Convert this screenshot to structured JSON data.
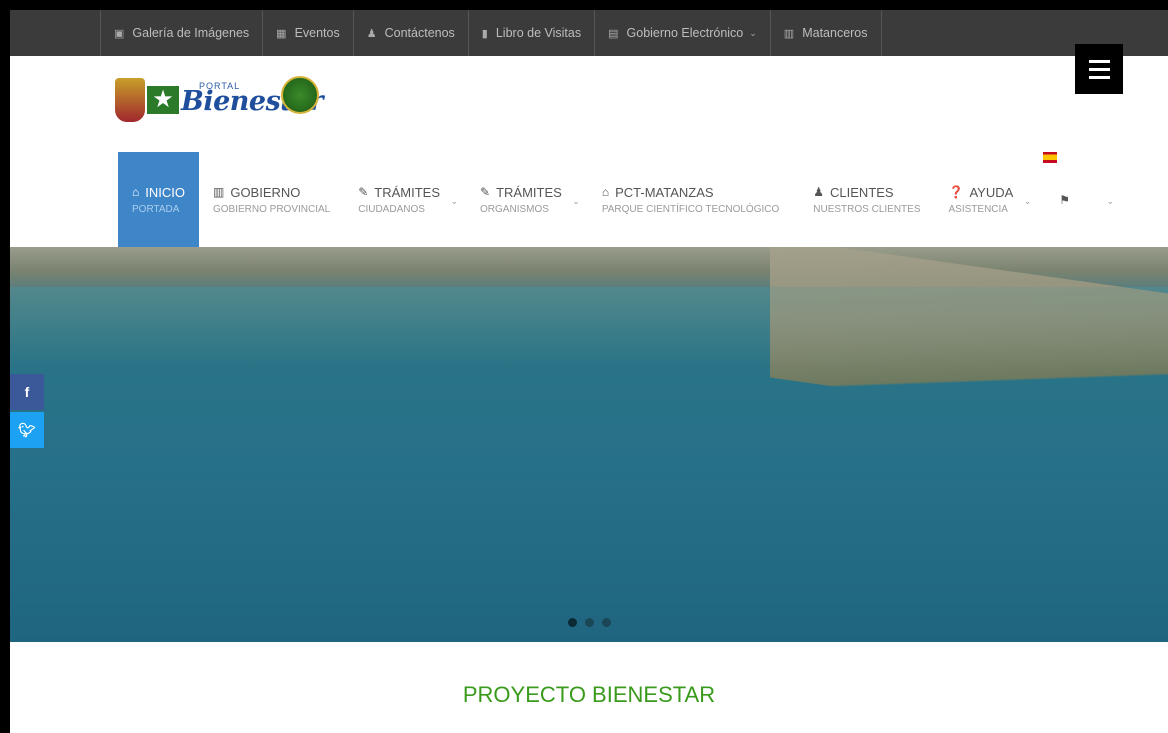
{
  "topbar": {
    "links": [
      {
        "label": "Galería de Imágenes",
        "icon": "image-icon"
      },
      {
        "label": "Eventos",
        "icon": "calendar-icon"
      },
      {
        "label": "Contáctenos",
        "icon": "user-icon"
      },
      {
        "label": "Libro de Visitas",
        "icon": "book-icon"
      },
      {
        "label": "Gobierno Electrónico",
        "icon": "id-card-icon",
        "dropdown": true
      },
      {
        "label": "Matanceros",
        "icon": "newspaper-icon"
      }
    ]
  },
  "logo": {
    "portal": "PORTAL",
    "brand": "Bienestar"
  },
  "nav": {
    "items": [
      {
        "title": "INICIO",
        "sub": "PORTADA",
        "icon": "home-icon",
        "active": true
      },
      {
        "title": "GOBIERNO",
        "sub": "GOBIERNO PROVINCIAL",
        "icon": "institution-icon"
      },
      {
        "title": "TRÁMITES",
        "sub": "CIUDADANOS",
        "icon": "edit-icon",
        "dropdown": true
      },
      {
        "title": "TRÁMITES",
        "sub": "ORGANISMOS",
        "icon": "edit-icon",
        "dropdown": true
      },
      {
        "title": "PCT-MATANZAS",
        "sub": "PARQUE CIENTÍFICO TECNOLÓGICO",
        "icon": "graduation-cap-icon"
      },
      {
        "title": "CLIENTES",
        "sub": "NUESTROS CLIENTES",
        "icon": "users-icon"
      },
      {
        "title": "AYUDA",
        "sub": "ASISTENCIA",
        "icon": "question-circle-icon",
        "dropdown": true
      }
    ]
  },
  "social": {
    "facebook": "f",
    "twitter": "t"
  },
  "slider": {
    "slides": 3,
    "active": 1
  },
  "section": {
    "title": "PROYECTO BIENESTAR"
  }
}
